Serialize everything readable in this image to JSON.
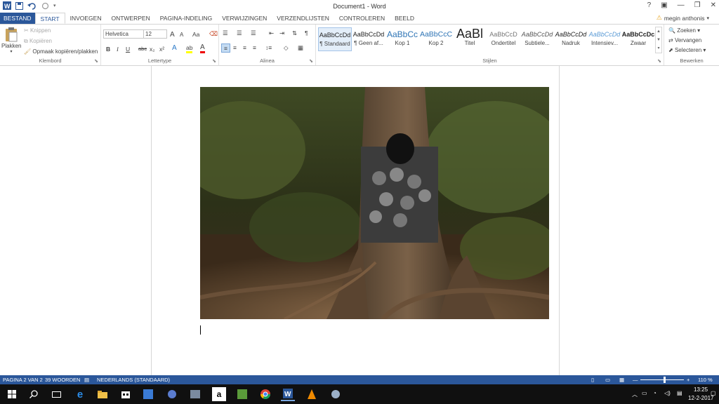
{
  "window": {
    "title": "Document1 - Word",
    "help": "?",
    "min": "—",
    "restore": "❐",
    "close": "✕"
  },
  "tabs": [
    {
      "label": "BESTAND"
    },
    {
      "label": "START"
    },
    {
      "label": "INVOEGEN"
    },
    {
      "label": "ONTWERPEN"
    },
    {
      "label": "PAGINA-INDELING"
    },
    {
      "label": "VERWIJZINGEN"
    },
    {
      "label": "VERZENDLIJSTEN"
    },
    {
      "label": "CONTROLEREN"
    },
    {
      "label": "BEELD"
    }
  ],
  "user": {
    "name": "megin anthonis",
    "arrow": "▾"
  },
  "clipboard": {
    "group": "Klembord",
    "paste": "Plakken",
    "cut": "Knippen",
    "copy": "Kopiëren",
    "format_painter": "Opmaak kopiëren/plakken"
  },
  "font": {
    "group": "Lettertype",
    "family": "Helvetica",
    "size": "12",
    "case": "Aa",
    "bold": "B",
    "italic": "I",
    "underline": "U",
    "strike": "abc",
    "sub": "x₂",
    "sup": "x²",
    "grow": "A",
    "shrink": "A",
    "color_label": "A"
  },
  "paragraph": {
    "group": "Alinea",
    "pilcrow": "¶"
  },
  "styles": {
    "group": "Stijlen",
    "items": [
      {
        "preview": "AaBbCcDd",
        "name": "¶ Standaard"
      },
      {
        "preview": "AaBbCcDd",
        "name": "¶ Geen af..."
      },
      {
        "preview": "AaBbCc",
        "name": "Kop 1"
      },
      {
        "preview": "AaBbCcC",
        "name": "Kop 2"
      },
      {
        "preview": "AaBl",
        "name": "Titel"
      },
      {
        "preview": "AaBbCcD",
        "name": "Ondertitel"
      },
      {
        "preview": "AaBbCcDd",
        "name": "Subtiele..."
      },
      {
        "preview": "AaBbCcDd",
        "name": "Nadruk"
      },
      {
        "preview": "AaBbCcDd",
        "name": "Intensiev..."
      },
      {
        "preview": "AaBbCcDc",
        "name": "Zwaar"
      }
    ]
  },
  "editing": {
    "group": "Bewerken",
    "find": "Zoeken",
    "replace": "Vervangen",
    "select": "Selecteren"
  },
  "status": {
    "page": "PAGINA 2 VAN 2",
    "words": "39 WOORDEN",
    "language": "NEDERLANDS (STANDAARD)",
    "zoom": "110 %",
    "zoom_level": 0.55
  },
  "taskbar": {
    "time": "13:25",
    "date": "12-2-2017"
  },
  "colors": {
    "accent": "#2b579a",
    "taskbar": "#101010"
  }
}
